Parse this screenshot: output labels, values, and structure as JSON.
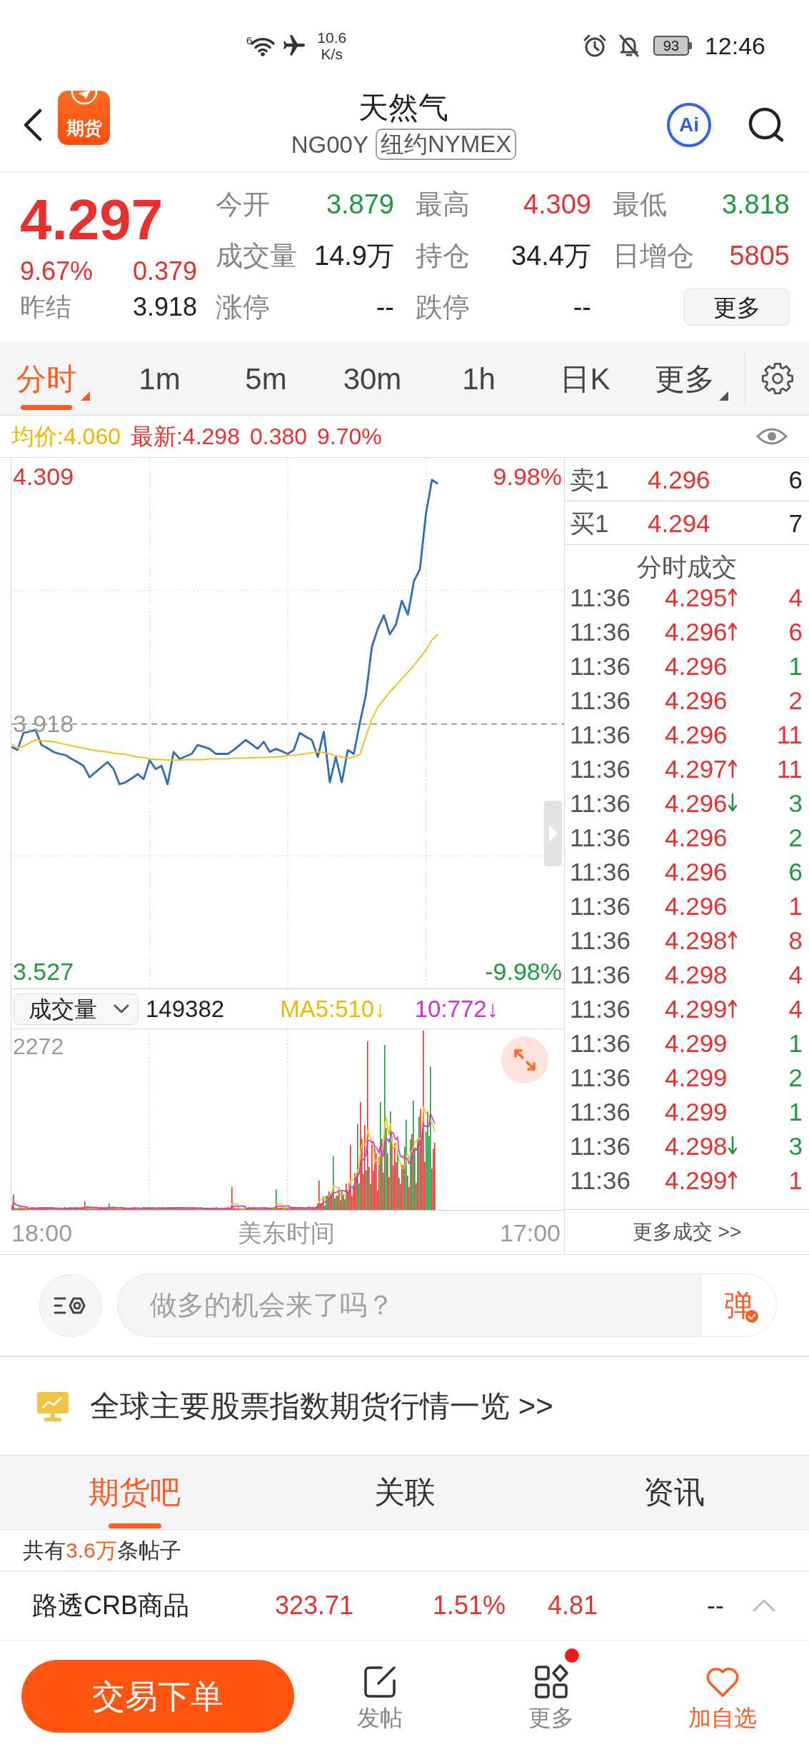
{
  "status_bar": {
    "wifi_label": "6",
    "speed": "10.6",
    "speed_unit": "K/s",
    "battery": "93",
    "time": "12:46"
  },
  "header": {
    "logo_text": "期货",
    "title": "天然气",
    "code": "NG00Y",
    "exchange": "纽约NYMEX",
    "ai_label": "Ai"
  },
  "quote": {
    "price": "4.297",
    "rising": true,
    "change_pct": "9.67%",
    "change": "0.379",
    "prev_label": "昨结",
    "prev_value": "3.918",
    "stats": [
      {
        "label": "今开",
        "value": "3.879",
        "color": "#1d9a3a"
      },
      {
        "label": "最高",
        "value": "4.309",
        "color": "#e8312e"
      },
      {
        "label": "最低",
        "value": "3.818",
        "color": "#1d9a3a"
      },
      {
        "label": "成交量",
        "value": "14.9万",
        "color": "#222222"
      },
      {
        "label": "持仓",
        "value": "34.4万",
        "color": "#222222"
      },
      {
        "label": "日增仓",
        "value": "5805",
        "color": "#e8312e"
      }
    ],
    "limits": [
      {
        "label": "涨停",
        "value": "--"
      },
      {
        "label": "跌停",
        "value": "--"
      }
    ],
    "more_button": "更多"
  },
  "period_tabs": [
    {
      "label": "分时",
      "selected": true,
      "has_menu": true
    },
    {
      "label": "1m",
      "selected": false,
      "has_menu": false
    },
    {
      "label": "5m",
      "selected": false,
      "has_menu": false
    },
    {
      "label": "30m",
      "selected": false,
      "has_menu": false
    },
    {
      "label": "1h",
      "selected": false,
      "has_menu": false
    },
    {
      "label": "日K",
      "selected": false,
      "has_menu": false
    },
    {
      "label": "更多",
      "selected": false,
      "has_menu": true
    }
  ],
  "info_line": {
    "average": "均价:4.060",
    "latest": "最新:4.298",
    "change": "0.380",
    "change_pct": "9.70%"
  },
  "price_chart": {
    "high_pct": "9.98%",
    "low_pct": "-9.98%",
    "chart_data": {
      "type": "line",
      "grid": true,
      "categories": [
        null,
        null,
        null,
        null,
        null,
        null,
        null,
        null,
        null,
        null,
        null,
        null,
        null,
        null,
        null,
        null,
        null,
        null,
        null,
        null,
        null,
        null,
        null,
        null,
        null,
        null,
        null,
        null,
        null,
        null,
        null,
        null,
        null,
        null,
        null,
        null,
        null,
        null,
        null,
        null,
        null,
        null,
        null,
        null,
        null,
        null,
        null,
        null,
        null,
        null,
        null,
        null,
        null,
        null,
        null,
        null,
        null,
        null,
        null,
        null,
        null,
        null,
        null,
        null,
        null,
        null,
        null,
        null,
        null,
        null,
        null,
        null,
        null,
        null,
        null,
        null,
        null,
        null,
        null,
        null,
        null,
        null,
        null,
        null,
        null,
        null,
        null,
        null,
        null,
        null,
        null,
        null,
        null
      ],
      "ylim": [
        3.5,
        4.339
      ],
      "yticks": [
        {
          "value": 4.309,
          "label": "4.309"
        },
        {
          "value": 3.918,
          "label": "3.918"
        },
        {
          "value": 3.527,
          "label": "3.527"
        }
      ],
      "ref_lines": [
        {
          "axis": "y",
          "value": 3.918
        }
      ],
      "series": [
        {
          "color": "#2f6db5",
          "values": [
            3.882,
            3.877,
            3.904,
            3.906,
            3.909,
            3.885,
            3.88,
            3.874,
            3.871,
            3.869,
            3.863,
            3.858,
            3.852,
            3.834,
            3.842,
            3.85,
            3.858,
            3.847,
            3.823,
            3.826,
            3.832,
            3.839,
            3.831,
            3.861,
            3.847,
            3.852,
            3.823,
            3.874,
            3.863,
            3.867,
            3.871,
            3.885,
            3.882,
            3.879,
            3.871,
            3.871,
            3.871,
            3.877,
            3.885,
            3.893,
            3.886,
            3.879,
            3.89,
            3.874,
            3.879,
            3.875,
            3.871,
            3.877,
            3.904,
            3.898,
            3.893,
            3.866,
            3.906,
            3.826,
            3.866,
            3.826,
            3.877,
            3.871,
            3.92,
            3.964,
            4.04,
            4.069,
            4.09,
            4.06,
            4.075,
            4.113,
            4.091,
            4.144,
            4.163,
            4.25,
            4.304,
            4.298,
            null,
            null,
            null,
            null,
            null,
            null,
            null,
            null,
            null,
            null,
            null,
            null,
            null,
            null,
            null,
            null,
            null,
            null,
            null,
            null,
            null
          ]
        },
        {
          "color": "#f2c21b",
          "values": [
            3.887,
            3.88,
            3.883,
            3.888,
            3.893,
            3.892,
            3.891,
            3.89,
            3.888,
            3.886,
            3.884,
            3.882,
            3.88,
            3.878,
            3.876,
            3.875,
            3.874,
            3.872,
            3.871,
            3.87,
            3.868,
            3.866,
            3.865,
            3.863,
            3.862,
            3.862,
            3.861,
            3.861,
            3.861,
            3.862,
            3.862,
            3.862,
            3.862,
            3.863,
            3.863,
            3.863,
            3.863,
            3.864,
            3.864,
            3.864,
            3.865,
            3.865,
            3.865,
            3.866,
            3.866,
            3.867,
            3.868,
            3.869,
            3.87,
            3.871,
            3.873,
            3.874,
            3.873,
            3.871,
            3.868,
            3.866,
            3.864,
            3.866,
            3.87,
            3.898,
            3.926,
            3.945,
            3.957,
            3.969,
            3.979,
            3.99,
            4.0,
            4.011,
            4.023,
            4.035,
            4.051,
            4.06,
            null,
            null,
            null,
            null,
            null,
            null,
            null,
            null,
            null,
            null,
            null,
            null,
            null,
            null,
            null,
            null,
            null,
            null,
            null,
            null,
            null
          ]
        }
      ]
    }
  },
  "volume": {
    "selector": "成交量",
    "total": "149382",
    "ma5": "MA5:510↓",
    "ma10": "10:772↓",
    "scale_max": "2272"
  },
  "time_axis": {
    "start": "18:00",
    "label": "美东时间",
    "end": "17:00"
  },
  "order_book": {
    "levels": [
      {
        "label": "卖1",
        "price": "4.296",
        "volume": "6"
      },
      {
        "label": "买1",
        "price": "4.294",
        "volume": "7"
      }
    ],
    "trades_title": "分时成交",
    "trades": [
      {
        "time": "11:36",
        "price": "4.295",
        "kind": "uptick",
        "volume": "4",
        "color": "#e8312e"
      },
      {
        "time": "11:36",
        "price": "4.296",
        "kind": "uptick",
        "volume": "6",
        "color": "#e8312e"
      },
      {
        "time": "11:36",
        "price": "4.296",
        "kind": "plain",
        "volume": "1",
        "color": "#1d9a3a"
      },
      {
        "time": "11:36",
        "price": "4.296",
        "kind": "plain",
        "volume": "2",
        "color": "#e8312e"
      },
      {
        "time": "11:36",
        "price": "4.296",
        "kind": "plain",
        "volume": "11",
        "color": "#e8312e"
      },
      {
        "time": "11:36",
        "price": "4.297",
        "kind": "uptick",
        "volume": "11",
        "color": "#e8312e"
      },
      {
        "time": "11:36",
        "price": "4.296",
        "kind": "downtick",
        "volume": "3",
        "color": "#1d9a3a"
      },
      {
        "time": "11:36",
        "price": "4.296",
        "kind": "plain",
        "volume": "2",
        "color": "#1d9a3a"
      },
      {
        "time": "11:36",
        "price": "4.296",
        "kind": "plain",
        "volume": "6",
        "color": "#1d9a3a"
      },
      {
        "time": "11:36",
        "price": "4.296",
        "kind": "plain",
        "volume": "1",
        "color": "#e8312e"
      },
      {
        "time": "11:36",
        "price": "4.298",
        "kind": "uptick",
        "volume": "8",
        "color": "#e8312e"
      },
      {
        "time": "11:36",
        "price": "4.298",
        "kind": "plain",
        "volume": "4",
        "color": "#e8312e"
      },
      {
        "time": "11:36",
        "price": "4.299",
        "kind": "uptick",
        "volume": "4",
        "color": "#e8312e"
      },
      {
        "time": "11:36",
        "price": "4.299",
        "kind": "plain",
        "volume": "1",
        "color": "#1d9a3a"
      },
      {
        "time": "11:36",
        "price": "4.299",
        "kind": "plain",
        "volume": "2",
        "color": "#1d9a3a"
      },
      {
        "time": "11:36",
        "price": "4.299",
        "kind": "plain",
        "volume": "1",
        "color": "#1d9a3a"
      },
      {
        "time": "11:36",
        "price": "4.298",
        "kind": "downtick",
        "volume": "3",
        "color": "#1d9a3a"
      },
      {
        "time": "11:36",
        "price": "4.299",
        "kind": "uptick",
        "volume": "1",
        "color": "#e8312e"
      }
    ],
    "more_link": "更多成交 >>"
  },
  "comment_bar": {
    "placeholder": "做多的机会来了吗？",
    "send_label": "弹"
  },
  "global_link": "全球主要股票指数期货行情一览 >>",
  "section_tabs": [
    {
      "label": "期货吧",
      "selected": true
    },
    {
      "label": "关联",
      "selected": false
    },
    {
      "label": "资讯",
      "selected": false
    }
  ],
  "post_count": {
    "prefix": "共有",
    "count": "3.6万",
    "suffix": "条帖子"
  },
  "index_bar": {
    "name": "路透CRB商品",
    "rising": true,
    "price": "323.71",
    "change_pct": "1.51%",
    "change": "4.81",
    "extra": "--"
  },
  "bottom_nav": {
    "trade_button": "交易下单",
    "items": [
      {
        "label": "发帖",
        "kind": "post",
        "badge": false,
        "highlighted": false
      },
      {
        "label": "更多",
        "kind": "grid",
        "badge": true,
        "highlighted": false
      },
      {
        "label": "加自选",
        "kind": "favorite",
        "badge": false,
        "highlighted": true
      }
    ]
  }
}
